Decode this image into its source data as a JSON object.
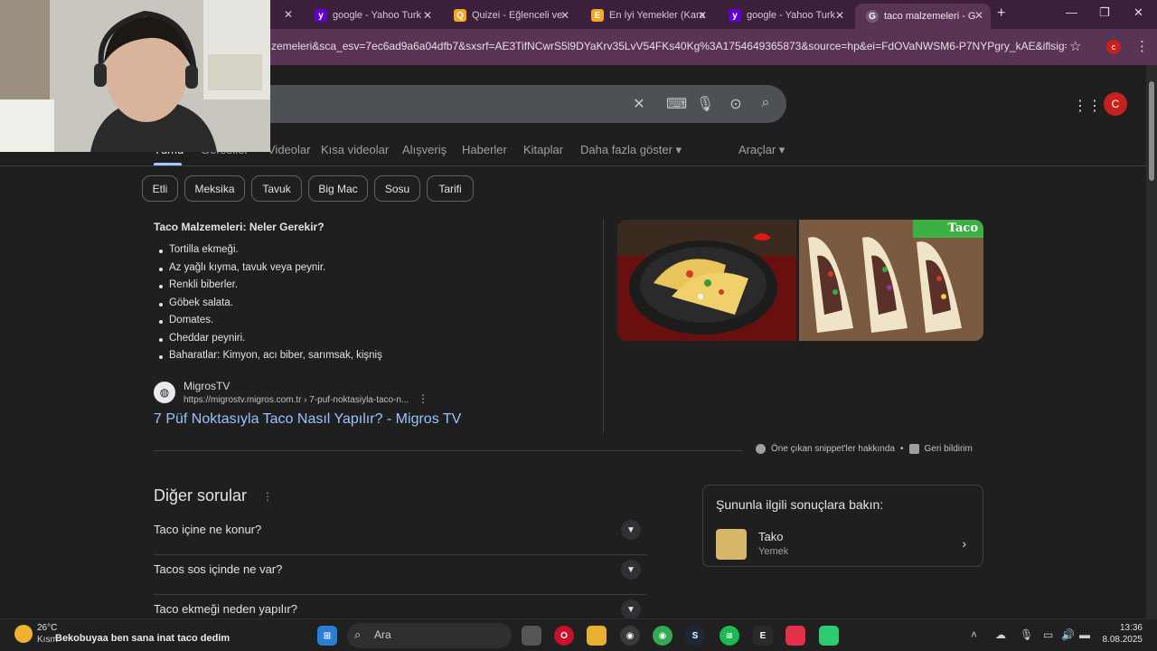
{
  "browser": {
    "tabs": [
      {
        "label": "google - Yahoo Turk",
        "fav": "y",
        "color": "#6001d2"
      },
      {
        "label": "Quizei - Eğlenceli ve",
        "fav": "Q",
        "color": "#f5a623"
      },
      {
        "label": "En İyi Yemekler (Kara",
        "fav": "E",
        "color": "#f5a623"
      },
      {
        "label": "google - Yahoo Turk",
        "fav": "y",
        "color": "#6001d2"
      },
      {
        "label": "taco malzemeleri - G",
        "fav": "G",
        "color": "#7a5a76"
      }
    ],
    "new_tab": "+",
    "url": "zemeleri&sca_esv=7ec6ad9a6a04dfb7&sxsrf=AE3TifNCwrS5l9DYaKrv35LvV54FKs40Kg%3A1754649365873&source=hp&ei=FdOVaNWSM6-P7NYPgry_kAE&iflsig=AOw8...",
    "profile_initial": "c"
  },
  "search": {
    "nav": [
      "Tümü",
      "Görseller",
      "Videolar",
      "Kısa videolar",
      "Alışveriş",
      "Haberler",
      "Kitaplar",
      "Daha fazla göster ▾",
      "Araçlar ▾"
    ],
    "profile_initial": "C",
    "chips": [
      "Etli",
      "Meksika",
      "Tavuk",
      "Big Mac",
      "Sosu",
      "Tarifi"
    ]
  },
  "snippet": {
    "title": "Taco Malzemeleri: Neler Gerekir?",
    "items": [
      "Tortilla ekmeği.",
      "Az yağlı kıyma, tavuk veya peynir.",
      "Renkli biberler.",
      "Göbek salata.",
      "Domates.",
      "Cheddar peyniri.",
      "Baharatlar: Kimyon, acı biber, sarımsak, kişniş"
    ],
    "image_badge": "Taco",
    "source_name": "MigrosTV",
    "source_url": "https://migrostv.migros.com.tr › 7-puf-noktasiyla-taco-n...",
    "link": "7 Püf Noktasıyla Taco Nasıl Yapılır? - Migros TV",
    "about": "Öne çıkan snippet'ler hakkında",
    "feedback": "Geri bildirim"
  },
  "paa": {
    "title": "Diğer sorular",
    "questions": [
      "Taco içine ne konur?",
      "Tacos sos içinde ne var?",
      "Taco ekmeği neden yapılır?"
    ]
  },
  "related": {
    "title": "Şununla ilgili sonuçlara bakın:",
    "name": "Tako",
    "sub": "Yemek"
  },
  "taskbar": {
    "weather_temp": "26°C",
    "weather_desc": "Kısm",
    "news": "Bekobuyaa   ben sana inat taco dedim",
    "search_placeholder": "Ara",
    "time": "13:36",
    "date": "8.08.2025"
  },
  "colors": {
    "tabstrip": "#3c1f3a",
    "toolbar": "#5a3454",
    "page_bg": "#1f1f1f",
    "link": "#99c3ff"
  }
}
